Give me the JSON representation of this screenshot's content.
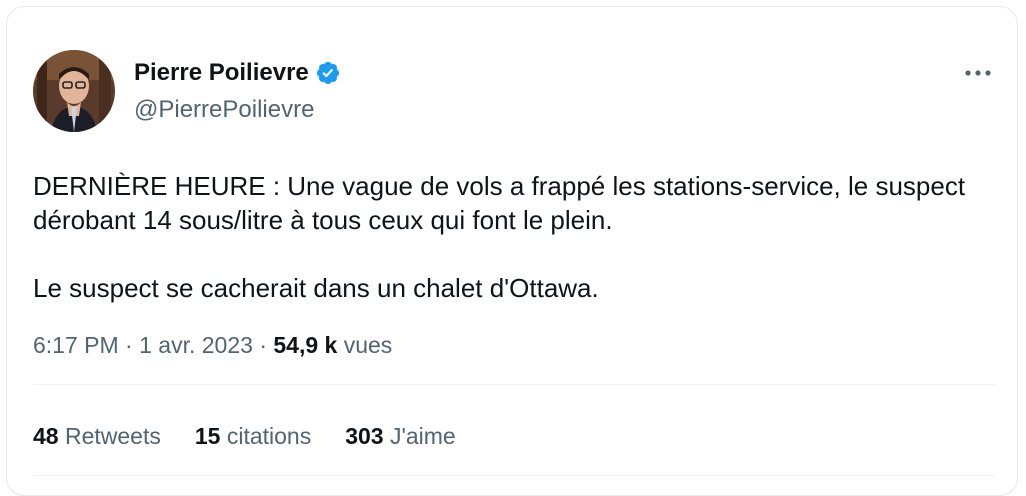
{
  "tweet": {
    "author_name": "Pierre Poilievre",
    "author_handle": "@PierrePoilievre",
    "verified_icon": "verified-badge-icon",
    "paragraphs": [
      "DERNIÈRE HEURE : Une vague de vols a frappé les stations-service, le suspect dérobant 14 sous/litre à tous ceux qui font le plein.",
      "Le suspect se cacherait dans un chalet d'Ottawa."
    ],
    "time": "6:17 PM",
    "separator": "·",
    "date": "1 avr. 2023",
    "views_count": "54,9 k",
    "views_label": "vues",
    "stats": [
      {
        "count": "48",
        "label": "Retweets"
      },
      {
        "count": "15",
        "label": "citations"
      },
      {
        "count": "303",
        "label": "J'aime"
      }
    ]
  },
  "colors": {
    "verified_blue": "#1d9bf0",
    "secondary_text": "#536471",
    "primary_text": "#0f1419"
  }
}
